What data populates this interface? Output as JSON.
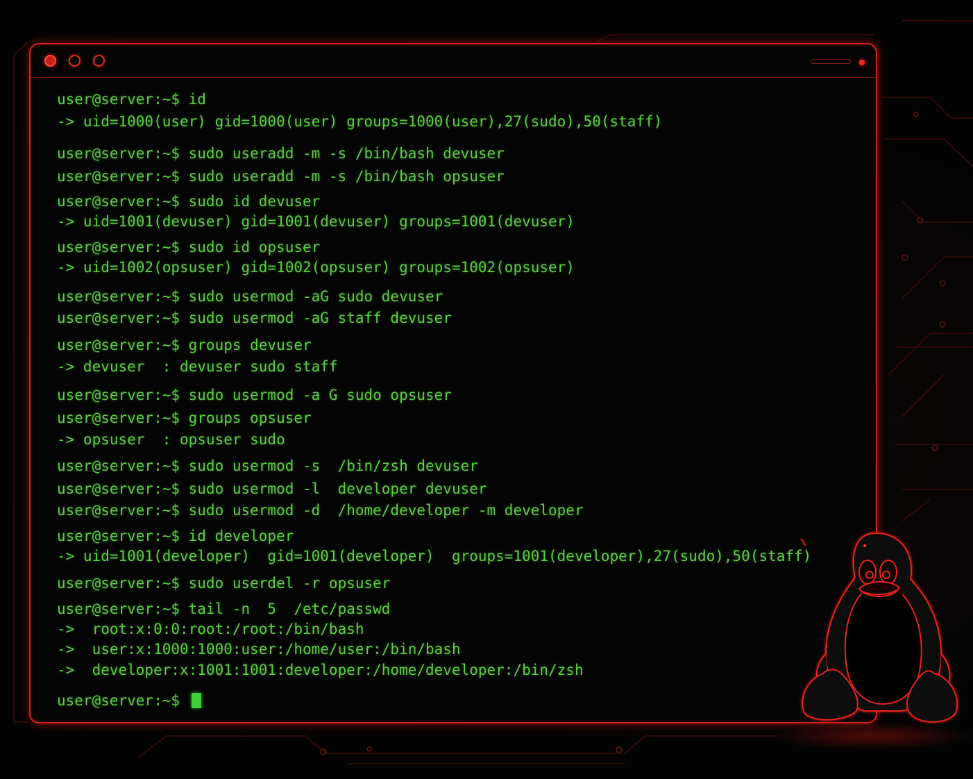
{
  "colors": {
    "accent_red": "#d4201c",
    "terminal_green": "#5fcb46",
    "cursor_green": "#3ed13a",
    "background": "#030303"
  },
  "window": {
    "buttons": [
      {
        "name": "close",
        "icon": "filled-red-circle-icon"
      },
      {
        "name": "minimize",
        "icon": "outlined-red-circle-icon"
      },
      {
        "name": "maximize",
        "icon": "outlined-red-circle-icon"
      }
    ]
  },
  "terminal": {
    "lines": [
      "user@server:~$ id",
      "-> uid=1000(user) gid=1000(user) groups=1000(user),27(sudo),50(staff)",
      "user@server:~$ sudo useradd -m -s /bin/bash devuser",
      "user@server:~$ sudo useradd -m -s /bin/bash opsuser",
      "user@server:~$ sudo id devuser",
      "-> uid=1001(devuser) gid=1001(devuser) groups=1001(devuser)",
      "user@server:~$ sudo id opsuser",
      "-> uid=1002(opsuser) gid=1002(opsuser) groups=1002(opsuser)",
      "user@server:~$ sudo usermod -aG sudo devuser",
      "user@server:~$ sudo usermod -aG staff devuser",
      "user@server:~$ groups devuser",
      "-> devuser  : devuser sudo staff",
      "user@server:~$ sudo usermod -a G sudo opsuser",
      "user@server:~$ groups opsuser",
      "-> opsuser  : opsuser sudo",
      "user@server:~$ sudo usermod -s  /bin/zsh devuser",
      "user@server:~$ sudo usermod -l  developer devuser",
      "user@server:~$ sudo usermod -d  /home/developer -m developer",
      "user@server:~$ id developer",
      "-> uid=1001(developer)  gid=1001(developer)  groups=1001(developer),27(sudo),50(staff)",
      "user@server:~$ sudo userdel -r opsuser",
      "user@server:~$ tail -n  5  /etc/passwd",
      "->  root:x:0:0:root:/root:/bin/bash",
      "->  user:x:1000:1000:user:/home/user:/bin/bash",
      "->  developer:x:1001:1001:developer:/home/developer:/bin/zsh"
    ],
    "prompt": "user@server:~$"
  },
  "decoration": {
    "mascot_icon": "linux-tux-penguin-icon"
  }
}
